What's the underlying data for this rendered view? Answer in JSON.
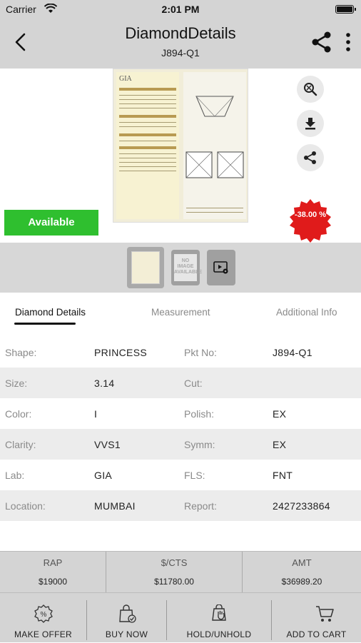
{
  "status_bar": {
    "carrier": "Carrier",
    "time": "2:01 PM"
  },
  "header": {
    "title": "DiamondDetails",
    "subtitle": "J894-Q1"
  },
  "media": {
    "availability": "Available",
    "availability_color": "#2fbf2f",
    "discount": "-38.00 %",
    "discount_color": "#e01b1b",
    "certificate_logo": "GIA",
    "side_icons": [
      "zoom-icon",
      "download-icon",
      "share-icon"
    ]
  },
  "thumbnails": {
    "no_image_text": "NO IMAGE AVAILABLE"
  },
  "tabs": [
    {
      "label": "Diamond Details",
      "active": true
    },
    {
      "label": "Measurement",
      "active": false
    },
    {
      "label": "Additional Info",
      "active": false
    }
  ],
  "details": [
    {
      "k1": "Shape:",
      "v1": "PRINCESS",
      "k2": "Pkt No:",
      "v2": "J894-Q1"
    },
    {
      "k1": "Size:",
      "v1": "3.14",
      "k2": "Cut:",
      "v2": ""
    },
    {
      "k1": "Color:",
      "v1": "I",
      "k2": "Polish:",
      "v2": "EX"
    },
    {
      "k1": "Clarity:",
      "v1": "VVS1",
      "k2": "Symm:",
      "v2": "EX"
    },
    {
      "k1": "Lab:",
      "v1": "GIA",
      "k2": "FLS:",
      "v2": "FNT"
    },
    {
      "k1": "Location:",
      "v1": "MUMBAI",
      "k2": "Report:",
      "v2": "2427233864"
    }
  ],
  "pricing": [
    {
      "label": "RAP",
      "value": "$19000"
    },
    {
      "label": "$/CTS",
      "value": "$11780.00"
    },
    {
      "label": "AMT",
      "value": "$36989.20"
    }
  ],
  "actions": [
    {
      "label": "MAKE OFFER",
      "icon": "offer-icon"
    },
    {
      "label": "BUY NOW",
      "icon": "bag-icon"
    },
    {
      "label": "HOLD/UNHOLD",
      "icon": "hold-icon"
    },
    {
      "label": "ADD TO CART",
      "icon": "cart-icon"
    }
  ]
}
